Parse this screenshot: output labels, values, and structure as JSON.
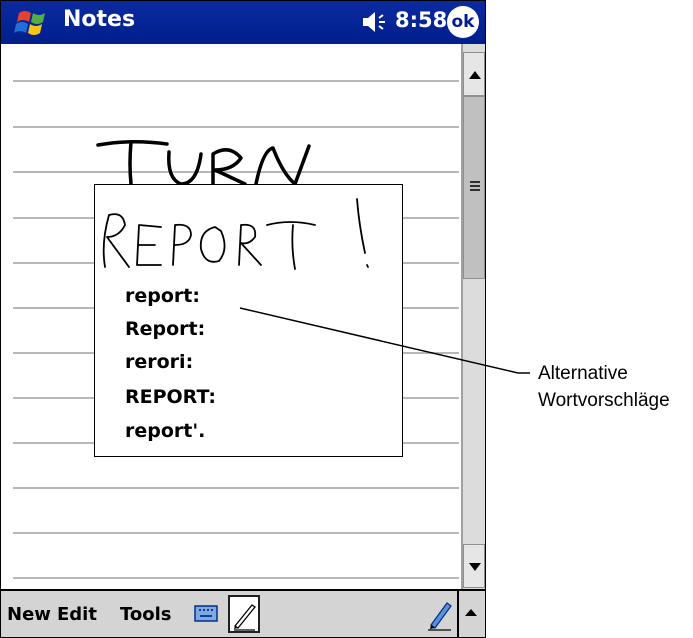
{
  "titlebar": {
    "app_title": "Notes",
    "time": "8:58",
    "ok_label": "ok",
    "start_icon": "windows-flag-icon",
    "speaker_icon": "speaker-icon"
  },
  "note": {
    "handwriting": "TURN"
  },
  "popup": {
    "handwriting": "REPORT!",
    "suggestions": [
      "report:",
      "Report:",
      "rerori:",
      "REPORT:",
      "report'."
    ]
  },
  "callout": {
    "line1": "Alternative",
    "line2": "Wortvorschläge"
  },
  "bottombar": {
    "menu_new": "New",
    "menu_edit": "Edit",
    "menu_tools": "Tools",
    "keyboard_icon": "keyboard-icon",
    "pen_icon": "pen-icon",
    "up_arrow_icon": "up-arrow-icon"
  },
  "colors": {
    "titlebar": "#001f8c",
    "toolbar": "#d4d4d4"
  }
}
